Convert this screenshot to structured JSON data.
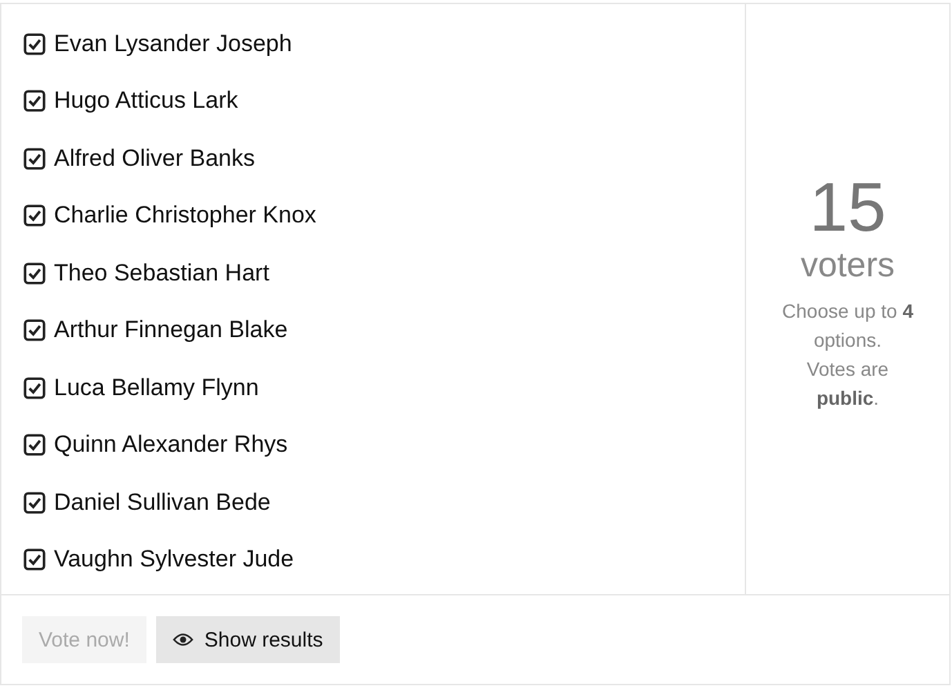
{
  "options": [
    {
      "label": "Evan Lysander Joseph",
      "checked": true
    },
    {
      "label": "Hugo Atticus Lark",
      "checked": true
    },
    {
      "label": "Alfred Oliver Banks",
      "checked": true
    },
    {
      "label": "Charlie Christopher Knox",
      "checked": true
    },
    {
      "label": "Theo Sebastian Hart",
      "checked": true
    },
    {
      "label": "Arthur Finnegan Blake",
      "checked": true
    },
    {
      "label": "Luca Bellamy Flynn",
      "checked": true
    },
    {
      "label": "Quinn Alexander Rhys",
      "checked": true
    },
    {
      "label": "Daniel Sullivan Bede",
      "checked": true
    },
    {
      "label": "Vaughn Sylvester Jude",
      "checked": true
    }
  ],
  "summary": {
    "count": "15",
    "unit": "voters",
    "rule": "Choose up to **4** options.",
    "visibility": "Votes are **public**."
  },
  "buttons": [
    {
      "label": "Vote now!",
      "kind": "vote",
      "disabled": true
    },
    {
      "label": "Show results",
      "kind": "results",
      "disabled": false
    }
  ]
}
